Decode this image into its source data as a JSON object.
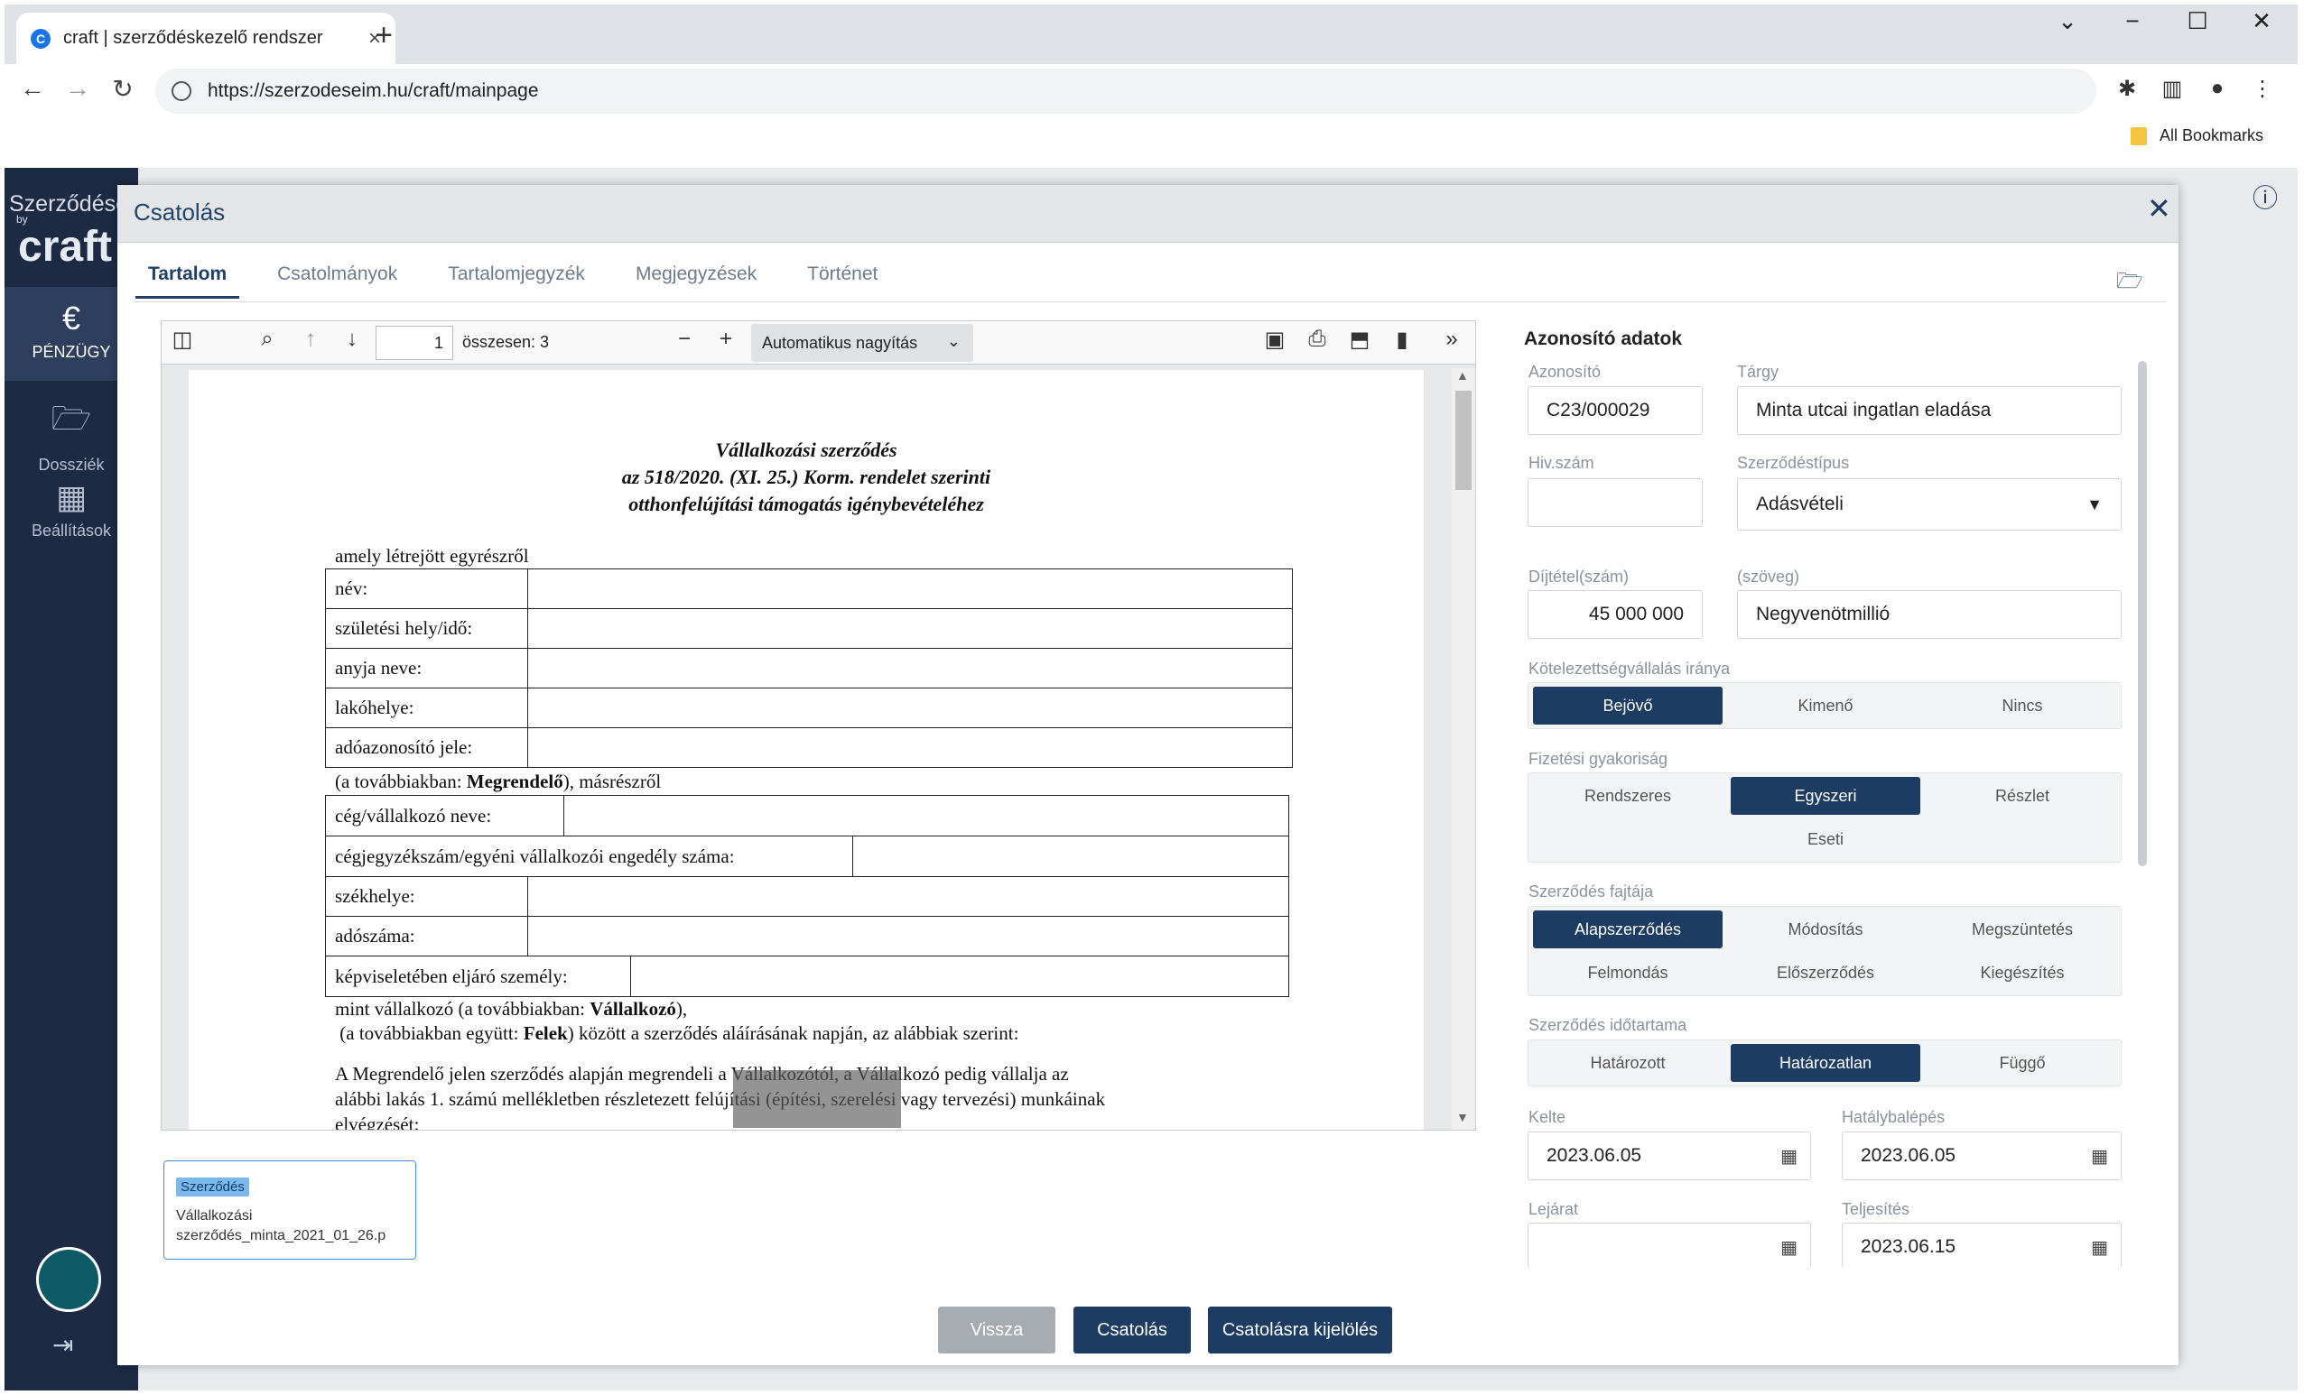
{
  "browser": {
    "tab_title": "craft | szerződéskezelő rendszer",
    "url": "https://szerzodeseim.hu/craft/mainpage",
    "bookmarks_label": "All Bookmarks"
  },
  "app": {
    "brand_top": "Szerződései",
    "brand_by": "by",
    "brand_name": "craft",
    "nav": [
      {
        "label": "PÉNZÜGY",
        "icon": "euro-icon"
      },
      {
        "label": "Dossziék",
        "icon": "folder-icon"
      },
      {
        "label": "Beállítások",
        "icon": "building-icon"
      }
    ]
  },
  "modal": {
    "title": "Csatolás",
    "tabs": [
      "Tartalom",
      "Csatolmányok",
      "Tartalomjegyzék",
      "Megjegyzések",
      "Történet"
    ]
  },
  "pdf": {
    "page": "1",
    "page_count": "összesen: 3",
    "zoom": "Automatikus nagyítás",
    "doc": {
      "heading1": "Vállalkozási szerződés",
      "heading2": "az 518/2020. (XI. 25.) Korm. rendelet szerinti",
      "heading3": "otthonfelújítási támogatás igénybevételéhez",
      "intro": "amely létrejött egyrészről",
      "table1": [
        "név:",
        "születési hely/idő:",
        "anyja neve:",
        "lakóhelye:",
        "adóazonosító jele:"
      ],
      "between1_a": "(a továbbiakban: ",
      "between1_b": "Megrendelő",
      "between1_c": "), másrészről",
      "table2_r1": "cég/vállalkozó neve:",
      "table2_r2": "cégjegyzékszám/egyéni vállalkozói engedély száma:",
      "table2_rest": [
        "székhelye:",
        "adószáma:"
      ],
      "table2_r5": "képviseletében eljáró személy:",
      "after1_a": "mint vállalkozó (a továbbiakban: ",
      "after1_b": "Vállalkozó",
      "after1_c": "),",
      "after2_a": " (a továbbiakban együtt: ",
      "after2_b": "Felek",
      "after2_c": ") között a szerződés aláírásának napján, az alábbiak szerint:",
      "para1": "A Megrendelő jelen szerződés alapján megrendeli a Vállalkozótól, a Vállalkozó pedig vállalja az",
      "para2": "alábbi lakás 1. számú mellékletben részletezett felújítási (építési, szerelési vagy tervezési) munkáinak",
      "para3": "elvégzését:"
    }
  },
  "attachment": {
    "badge": "Szerződés",
    "filename": "Vállalkozási szerződés_minta_2021_01_26.p"
  },
  "form": {
    "section_title": "Azonosító adatok",
    "azonosito_label": "Azonosító",
    "azonosito_value": "C23/000029",
    "targy_label": "Tárgy",
    "targy_value": "Minta utcai ingatlan eladása",
    "hivszam_label": "Hiv.szám",
    "hivszam_value": "",
    "tipus_label": "Szerződéstípus",
    "tipus_value": "Adásvételi",
    "dijtetel_label": "Díjtétel(szám)",
    "dijtetel_value": "45 000 000",
    "szoveg_label": "(szöveg)",
    "szoveg_value": "Negyvenötmillió",
    "irany_label": "Kötelezettségvállalás iránya",
    "irany_options": [
      "Bejövő",
      "Kimenő",
      "Nincs"
    ],
    "gyakorisag_label": "Fizetési gyakoriság",
    "gyakorisag_options": [
      "Rendszeres",
      "Egyszeri",
      "Részlet",
      "Eseti"
    ],
    "fajta_label": "Szerződés fajtája",
    "fajta_options": [
      "Alapszerződés",
      "Módosítás",
      "Megszüntetés",
      "Felmondás",
      "Előszerződés",
      "Kiegészítés"
    ],
    "idotartam_label": "Szerződés időtartama",
    "idotartam_options": [
      "Határozott",
      "Határozatlan",
      "Függő"
    ],
    "kelte_label": "Kelte",
    "kelte_value": "2023.06.05",
    "hatalyba_label": "Hatálybalépés",
    "hatalyba_value": "2023.06.05",
    "lejarat_label": "Lejárat",
    "lejarat_value": "",
    "teljesites_label": "Teljesítés",
    "teljesites_value": "2023.06.15"
  },
  "footer": {
    "back": "Vissza",
    "attach": "Csatolás",
    "mark": "Csatolásra kijelölés"
  }
}
